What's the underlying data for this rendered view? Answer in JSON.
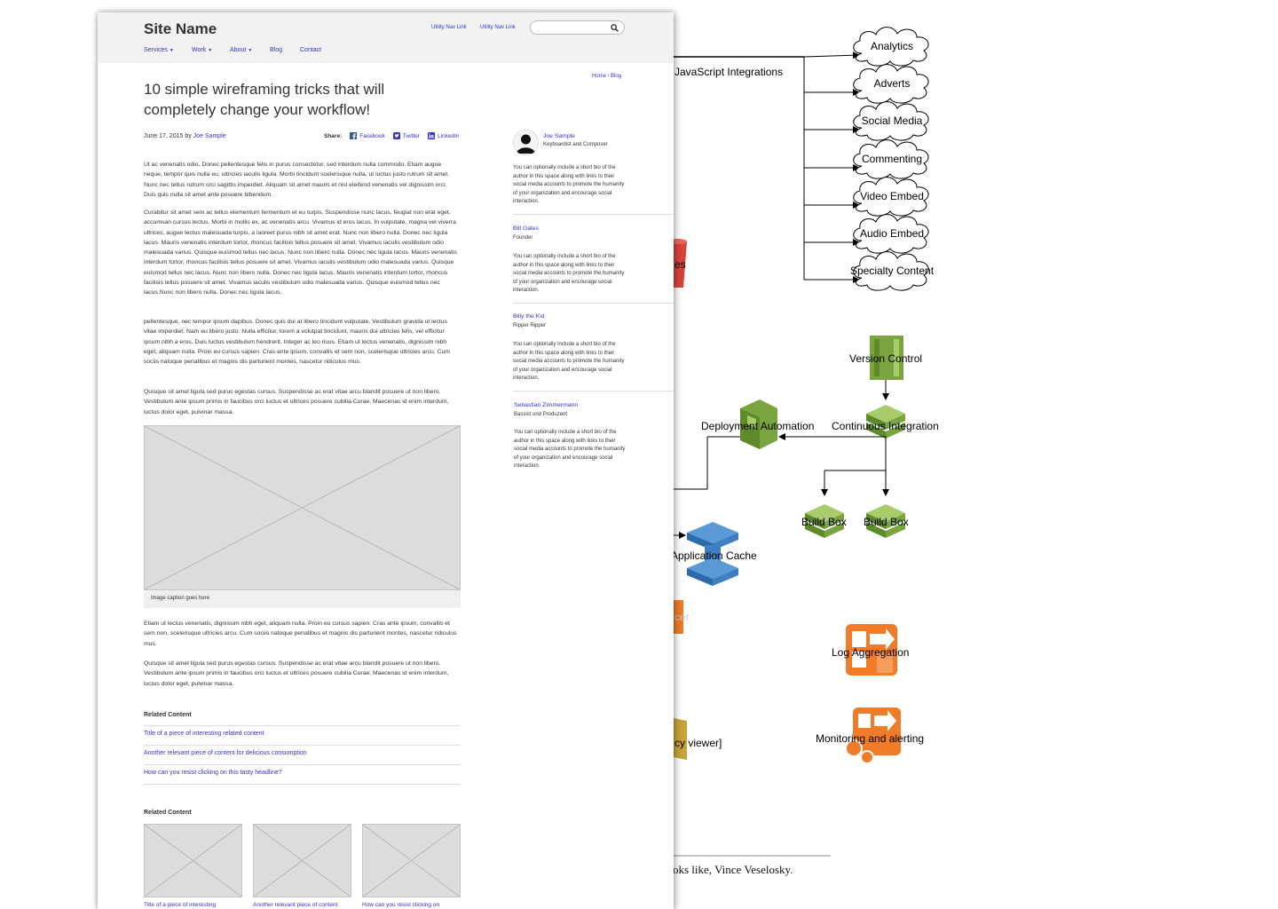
{
  "diagram": {
    "js_integrations_label": "JavaScript Integrations",
    "clouds": [
      "Analytics",
      "Adverts",
      "Social Media",
      "Commenting",
      "Video Embed",
      "Audio Embed",
      "Specialty Content"
    ],
    "version_control": "Version Control",
    "continuous_integration": "Continuous Integration",
    "deployment_automation": "Deployment Automation",
    "build_box_1": "Build Box",
    "build_box_2": "Build Box",
    "application_cache": "Application Cache",
    "log_aggregation": "Log Aggregation",
    "monitoring": "Monitoring and alerting",
    "partial_es": "es",
    "partial_cer": "cer",
    "partial_viewer": "cy viewer]",
    "caption_tail": "oks like, Vince Veselosky.",
    "colors": {
      "aws_green": "#7aa43f",
      "aws_blue": "#3d7fc1",
      "aws_orange": "#f07c2a",
      "aws_red": "#d9443b",
      "aws_gold": "#c9a43a"
    }
  },
  "wireframe": {
    "site_name": "Site Name",
    "utility_links": [
      "Utility Nav Link",
      "Utility Nav Link"
    ],
    "search_placeholder": "",
    "nav": [
      "Services",
      "Work",
      "About",
      "Blog",
      "Contact"
    ],
    "breadcrumb": {
      "home": "Home",
      "sep": "/",
      "current": "Blog"
    },
    "title": "10 simple wireframing tricks that will completely change your workflow!",
    "date_by": "June 17, 2015 by",
    "author_link": "Joe Sample",
    "share": {
      "label": "Share:",
      "facebook": "Facebook",
      "twitter": "Twitter",
      "linkedin": "LinkedIn"
    },
    "paragraphs": [
      "Ut ac venenatis odio. Donec pellentesque felis in purus consectetur, sed interdum nulla commodo. Etiam augue neque, tempor quis nulla eu, ultricies iaculis ligula. Morbi tincidunt scelerisque nulla, ut luctus justo rutrum sit amet. Nunc nec tellus rutrum orci sagittis imperdiet. Aliquam sit amet mauris et nisl eleifend venenatis vel dignissim orci. Duis quis nulla sit amet ante posuere bibendum.",
      "Curabitur sit amet sem ac tellus elementum fermentum et eu turpis. Suspendisse nunc lacus, feugiat non erat eget, accumsan cursus lectus. Morbi in mollis ex, ac venenatis arcu. Vivamus id eros lacus. In vulputate, magna vel viverra ultrices, augue lectus malesuada turpis, a laoreet purus nibh sit amet erat. Nunc non libero nulla. Donec nec ligula lacus. Mauris venenatis interdum tortor, rhoncus facilisis tellus posuere sit amet. Vivamus iaculis vestibulum odio malesuada varius. Quisque euismod tellus nec lacus. Nunc non libero nulla. Donec nec ligula lacus. Mauris venenatis interdum tortor, rhoncus facilisis tellus posuere sit amet. Vivamus iaculis vestibulum odio malesuada varius. Quisque euismod tellus nec lacus. Nunc non libero nulla. Donec nec ligula lacus. Mauris venenatis interdum tortor, rhoncus facilisis tellus posuere sit amet. Vivamus iaculis vestibulum odio malesuada varius. Quisque euismod tellus nec lacus.Nunc non libero nulla. Donec nec ligula lacus.",
      "pellentesque, nec tempor ipsum dapibus. Donec quis dui at libero tincidunt vulputate. Vestibulum gravida ut lectus vitae imperdiet. Nam eu libero justo. Nulla efficitur, lorem a volutpat tincidunt, mauris dui ultricies felis, vel efficitur ipsum nibh a eros. Duis luctus vestibulum hendrerit. Integer ac leo risus. Etiam ut lectus venenatis, dignissim nibh eget, aliquam nulla. Proin eu cursus sapien. Cras ante ipsum, convallis et sem non, scelerisque ultricies arcu. Cum sociis natoque penatibus et magnis dis parturient montes, nascetur ridiculus mus.",
      "Quisque sit amet ligula sed purus egestas cursus. Suspendisse ac erat vitae arcu blandit posuere ut non libero. Vestibulum ante ipsum primis in faucibus orci luctus et ultrices posuere cubilia Curae; Maecenas id enim interdum, luctus dolor eget, pulvinar massa.",
      "Etiam ut lectus venenatis, dignissim nibh eget, aliquam nulla. Proin eu cursus sapien. Cras ante ipsum, convallis et sem non, scelerisque ultricies arcu. Cum sociis natoque penatibus et magnis dis parturient montes, nascetur ridiculus mus.",
      "Quisque sit amet ligula sed purus egestas cursus. Suspendisse ac erat vitae arcu blandit posuere ut non libero. Vestibulum ante ipsum primis in faucibus orci luctus et ultrices posuere cubilia Curae; Maecenas id enim interdum, luctus dolor eget, pulvinar massa."
    ],
    "image_caption": "Image caption goes here",
    "related_heading": "Related Content",
    "related_links": [
      "Title of a piece of interesting related content",
      "Another relevant piece of content for delicious consumption",
      "How can you resist clicking on this tasty headline?"
    ],
    "related_heading_2": "Related Content",
    "thumb_captions": [
      "Title of a piece of interesting",
      "Another relevant piece of content",
      "How can you resist clicking on"
    ],
    "authors": [
      {
        "name": "Joe Sample",
        "role": "Keyboardist and Composer",
        "bio": "You can optionally include a short bio of the author in this space along with links to their social media accounts to promote the humanity of your organization and encourage social interaction."
      },
      {
        "name": "Bill Gates",
        "role": "Founder",
        "bio": "You can optionally include a short bio of the author in this space along with links to their social media accounts to promote the humanity of your organization and encourage social interaction."
      },
      {
        "name": "Billy the Kid",
        "role": "Ripper Ripper",
        "bio": "You can optionally include a short bio of the author in this space along with links to their social media accounts to promote the humanity of your organization and encourage social interaction."
      },
      {
        "name": "Sebastian Zimmermann",
        "role": "Bassist und Produzent",
        "bio": "You can optionally include a short bio of the author in this space along with links to their social media accounts to promote the humanity of your organization and encourage social interaction."
      }
    ]
  }
}
